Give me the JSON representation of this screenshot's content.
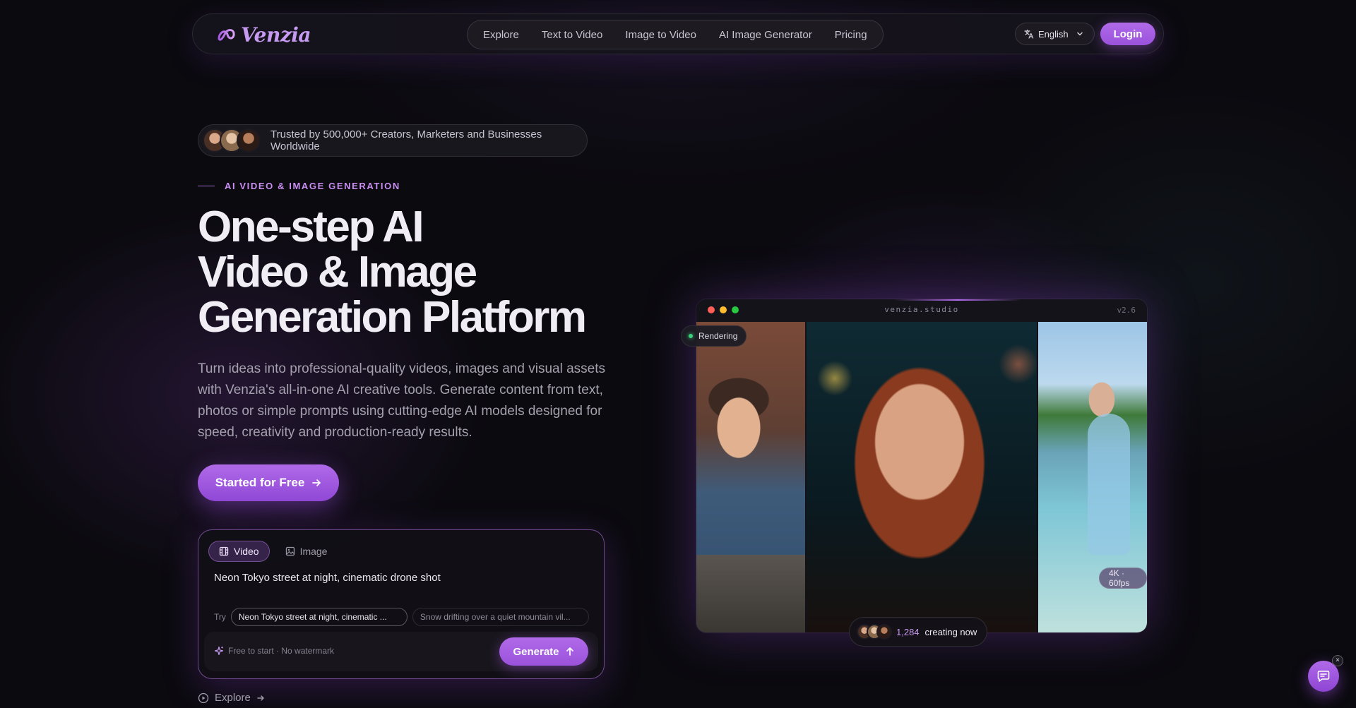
{
  "brand": {
    "name": "Venzia",
    "accent": "#b06ae8"
  },
  "nav": {
    "links": [
      "Explore",
      "Text to Video",
      "Image to Video",
      "AI Image Generator",
      "Pricing"
    ],
    "language": "English",
    "login": "Login"
  },
  "hero": {
    "trust_text": "Trusted by 500,000+ Creators, Marketers and Businesses Worldwide",
    "eyebrow": "AI VIDEO & IMAGE GENERATION",
    "headline_lines": [
      "One-step AI",
      "Video & Image",
      "Generation Platform"
    ],
    "subtitle": "Turn ideas into professional-quality videos, images and visual assets with Venzia's all-in-one AI creative tools. Generate content from text, photos or simple prompts using cutting-edge AI models designed for speed, creativity and production-ready results.",
    "cta": "Started for Free"
  },
  "prompt_card": {
    "tabs": [
      "Video",
      "Image"
    ],
    "active_tab": "Video",
    "prompt": "Neon Tokyo street at night, cinematic drone shot",
    "try_label": "Try",
    "suggestions": [
      "Neon Tokyo street at night, cinematic ...",
      "Snow drifting over a quiet mountain vil..."
    ],
    "footnote": "Free to start · No watermark",
    "generate": "Generate"
  },
  "explore_link": "Explore",
  "preview": {
    "domain": "venzia.studio",
    "version": "v2.6",
    "status": "Rendering",
    "resolution": "4K · 60fps",
    "creating_count": "1,284",
    "creating_label": "creating now"
  },
  "icons": {
    "logo": "logo-icon",
    "language": "translate-icon",
    "chevron": "chevron-down-icon",
    "arrow_right": "arrow-right-icon",
    "video": "film-icon",
    "image": "image-icon",
    "sparkle": "sparkle-icon",
    "arrow_up": "arrow-up-icon",
    "play": "play-circle-icon",
    "chat": "chat-icon",
    "close": "close-icon"
  }
}
